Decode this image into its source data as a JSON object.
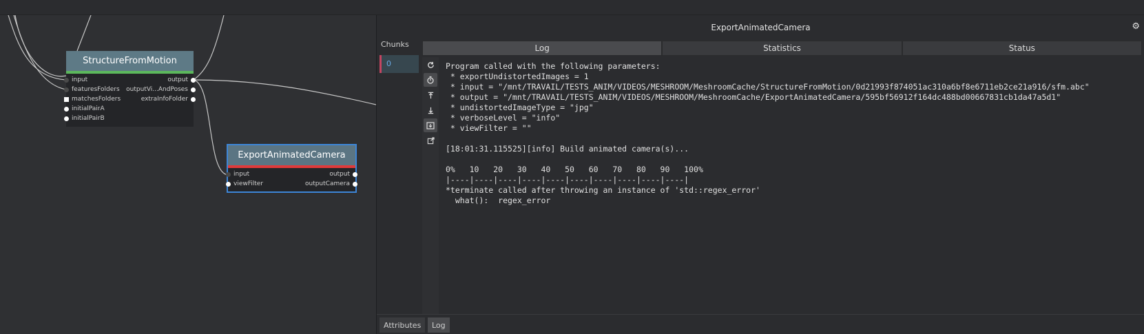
{
  "graph": {
    "nodes": {
      "sfm": {
        "title": "StructureFromMotion",
        "strip_color": "#5cb85c",
        "inputs": [
          "input",
          "featuresFolders",
          "matchesFolders",
          "initialPairA",
          "initialPairB"
        ],
        "outputs": [
          "output",
          "outputVi...AndPoses",
          "extraInfoFolder"
        ]
      },
      "eac": {
        "title": "ExportAnimatedCamera",
        "strip_color": "#e03a3a",
        "inputs": [
          "input",
          "viewFilter"
        ],
        "outputs": [
          "output",
          "outputCamera"
        ]
      }
    }
  },
  "panel": {
    "title": "ExportAnimatedCamera",
    "settings_icon": "gear-icon",
    "chunks_label": "Chunks",
    "chunks": [
      "0"
    ],
    "tabs": [
      "Log",
      "Statistics",
      "Status"
    ],
    "toolbar_icons": [
      "refresh-icon",
      "auto-refresh-icon",
      "scroll-top-icon",
      "scroll-bottom-icon",
      "follow-icon",
      "open-external-icon"
    ],
    "log_text": "Program called with the following parameters:\n * exportUndistortedImages = 1\n * input = \"/mnt/TRAVAIL/TESTS_ANIM/VIDEOS/MESHROOM/MeshroomCache/StructureFromMotion/0d21993f874051ac310a6bf8e6711eb2ce21a916/sfm.abc\"\n * output = \"/mnt/TRAVAIL/TESTS_ANIM/VIDEOS/MESHROOM/MeshroomCache/ExportAnimatedCamera/595bf56912f164dc488bd00667831cb1da47a5d1\"\n * undistortedImageType = \"jpg\"\n * verboseLevel = \"info\"\n * viewFilter = \"\"\n\n[18:01:31.115525][info] Build animated camera(s)...\n\n0%   10   20   30   40   50   60   70   80   90   100%\n|----|----|----|----|----|----|----|----|----|----|\n*terminate called after throwing an instance of 'std::regex_error'\n  what():  regex_error",
    "bottom_tabs": [
      "Attributes",
      "Log"
    ]
  }
}
